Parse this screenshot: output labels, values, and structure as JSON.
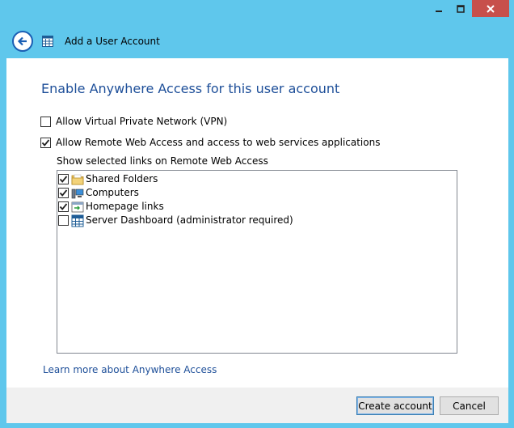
{
  "window": {
    "title": "",
    "controls": {
      "minimize": "minimize",
      "maximize": "maximize",
      "close": "close"
    }
  },
  "header": {
    "title": "Add a User Account"
  },
  "main": {
    "heading": "Enable Anywhere Access for this user account",
    "vpn": {
      "label": "Allow Virtual Private Network (VPN)",
      "checked": false
    },
    "rwa": {
      "label": "Allow Remote Web Access and access to web services applications",
      "checked": true
    },
    "links_label": "Show selected links on Remote Web Access",
    "links": [
      {
        "label": "Shared Folders",
        "checked": true,
        "icon": "folder-icon"
      },
      {
        "label": "Computers",
        "checked": true,
        "icon": "computer-icon"
      },
      {
        "label": "Homepage links",
        "checked": true,
        "icon": "homepage-links-icon"
      },
      {
        "label": "Server Dashboard (administrator required)",
        "checked": false,
        "icon": "dashboard-icon"
      }
    ],
    "learn_more": "Learn more about Anywhere Access"
  },
  "footer": {
    "create_label": "Create account",
    "cancel_label": "Cancel"
  },
  "colors": {
    "titlebar": "#5fc7ec",
    "accent_text": "#1e4f99",
    "close_button": "#c7504b"
  }
}
